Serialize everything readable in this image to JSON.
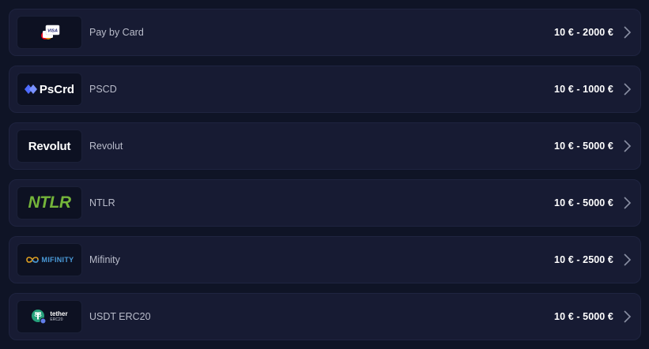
{
  "methods": [
    {
      "name": "Pay by Card",
      "range": "10 € - 2000 €",
      "logo_icon": "visa-mastercard-card-icon",
      "logo_text": "VISA"
    },
    {
      "name": "PSCD",
      "range": "10 € - 1000 €",
      "logo_icon": "pscrd-logo-icon",
      "logo_text": "PsCrd"
    },
    {
      "name": "Revolut",
      "range": "10 € - 5000 €",
      "logo_icon": "revolut-logo-icon",
      "logo_text": "Revolut"
    },
    {
      "name": "NTLR",
      "range": "10 € - 5000 €",
      "logo_icon": "ntlr-logo-icon",
      "logo_text": "NTLR"
    },
    {
      "name": "Mifinity",
      "range": "10 € - 2500 €",
      "logo_icon": "mifinity-logo-icon",
      "logo_text": "MIFINITY"
    },
    {
      "name": "USDT ERC20",
      "range": "10 € - 5000 €",
      "logo_icon": "tether-logo-icon",
      "logo_text": "tether",
      "logo_subtext": "ERC20"
    }
  ],
  "colors": {
    "background": "#0f1426",
    "row": "#171b33",
    "ntlr_green": "#74b43a",
    "tether_green": "#26a17b",
    "pscd_blue": "#4e6bff"
  }
}
